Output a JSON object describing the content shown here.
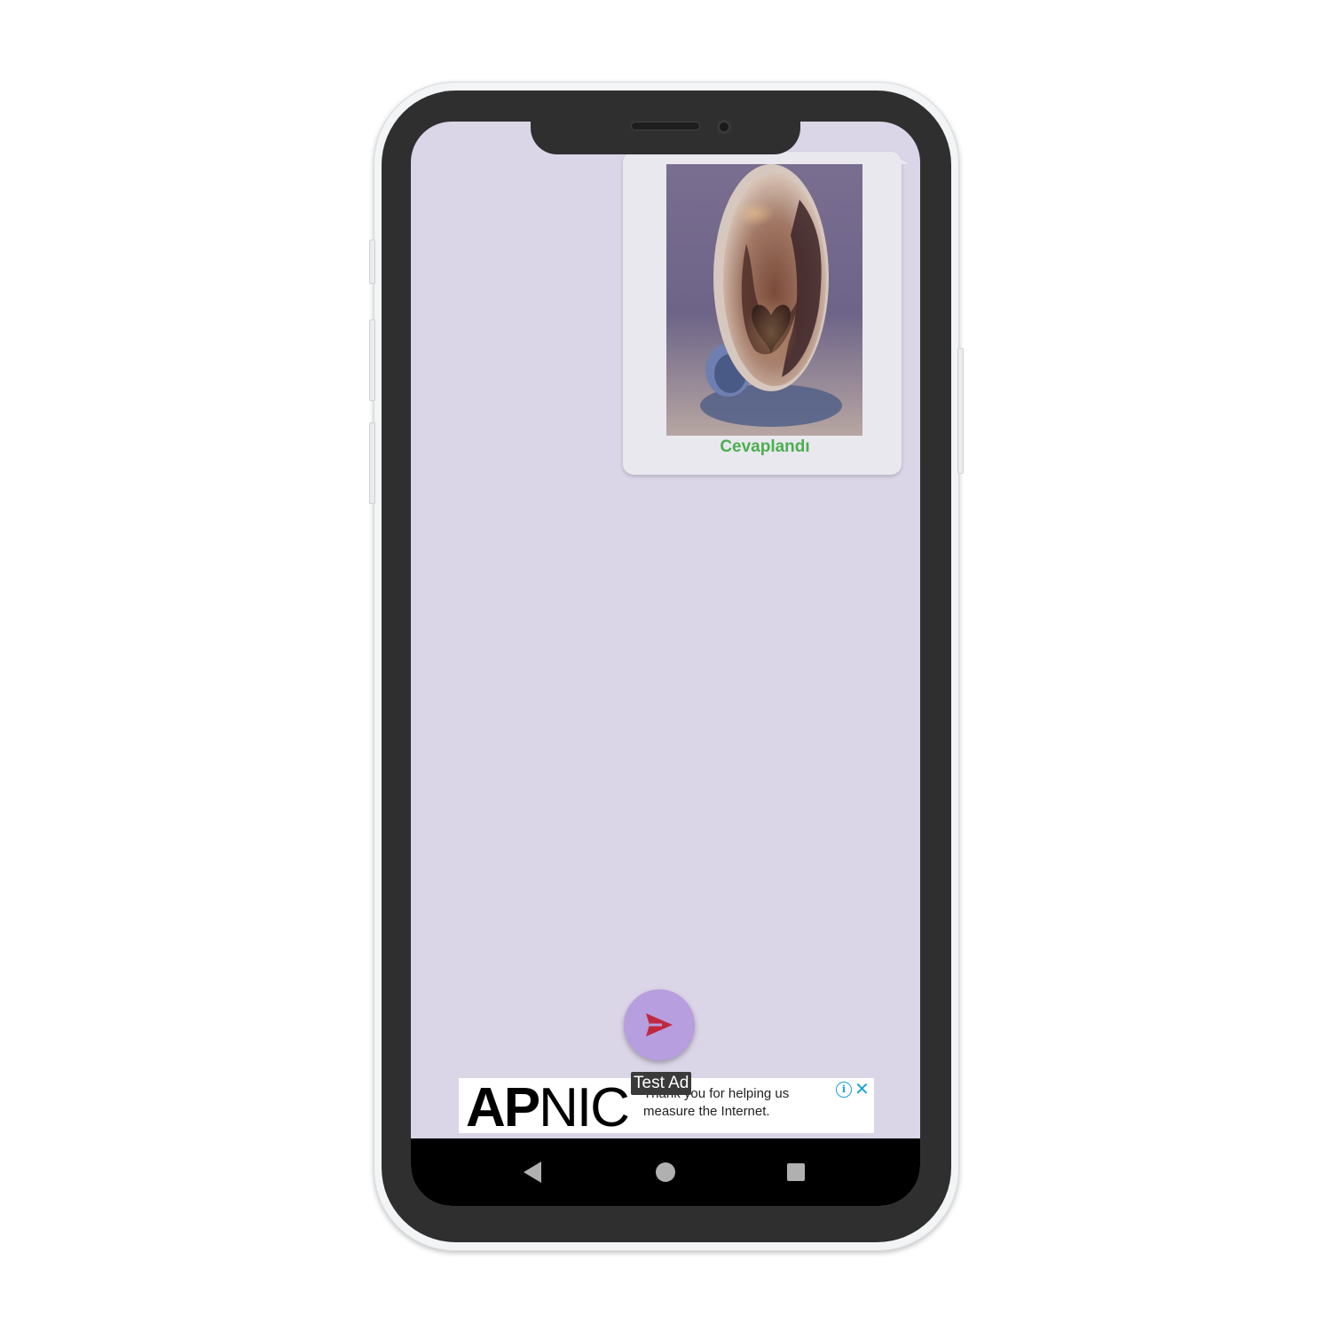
{
  "message": {
    "status": "Cevaplandı",
    "status_color": "#4caf50",
    "photo_icon": "coffee-cup-photo"
  },
  "compose": {
    "send_icon": "send-icon"
  },
  "ad": {
    "logo_bold": "AP",
    "logo_light": "NIC",
    "text": "Thank you for helping us measure the Internet.",
    "label": "Test Ad",
    "info_icon": "info-icon",
    "close_icon": "close-icon"
  },
  "navigation": {
    "back_icon": "back-icon",
    "home_icon": "home-icon",
    "recents_icon": "recents-icon"
  },
  "colors": {
    "background": "#dbd5e8",
    "card": "#e9e8ee",
    "fab": "#b79ede",
    "send_arrow": "#c0283f",
    "ad_accent": "#1aa3d6"
  }
}
